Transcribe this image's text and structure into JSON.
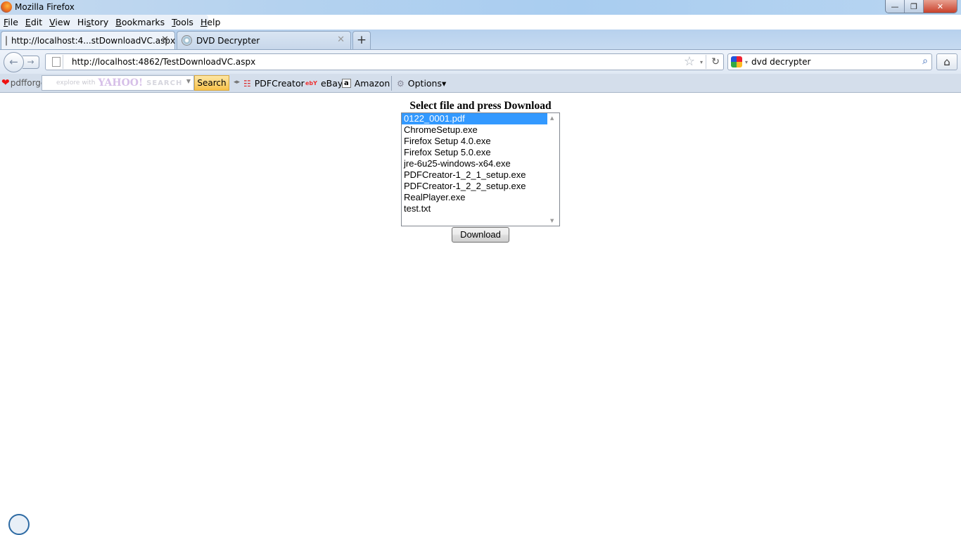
{
  "window": {
    "title": "Mozilla Firefox",
    "controls": {
      "minimize": "—",
      "maximize": "❐",
      "close": "✕"
    }
  },
  "menubar": {
    "items": [
      {
        "label": "File",
        "key": "F",
        "rest": "ile"
      },
      {
        "label": "Edit",
        "key": "E",
        "rest": "dit"
      },
      {
        "label": "View",
        "key": "V",
        "rest": "iew"
      },
      {
        "label": "History",
        "pre": "Hi",
        "key": "s",
        "rest": "tory"
      },
      {
        "label": "Bookmarks",
        "key": "B",
        "rest": "ookmarks"
      },
      {
        "label": "Tools",
        "key": "T",
        "rest": "ools"
      },
      {
        "label": "Help",
        "key": "H",
        "rest": "elp"
      }
    ]
  },
  "tabs": [
    {
      "label": "http://localhost:4...stDownloadVC.aspx",
      "active": true,
      "close": "✕"
    },
    {
      "label": "DVD Decrypter",
      "active": false,
      "close": "✕"
    }
  ],
  "new_tab": "+",
  "navbar": {
    "back_icon": "←",
    "forward_icon": "→",
    "url": "http://localhost:4862/TestDownloadVC.aspx",
    "star_icon": "☆",
    "dropdown_icon": "▾",
    "reload_icon": "↻",
    "search_query": "dvd decrypter",
    "search_icon": "⌕",
    "home_icon": "⌂"
  },
  "pdfforge_toolbar": {
    "logo": "pdfforge",
    "yahoo_prefix": "explore with",
    "yahoo_brand": "YAHOO!",
    "yahoo_search_word": "SEARCH",
    "search_button": "Search",
    "items": [
      {
        "name": "pdfcreator",
        "icon": "☷",
        "label": "PDFCreator"
      },
      {
        "name": "ebay",
        "icon": "ebY",
        "label": "eBay"
      },
      {
        "name": "amazon",
        "icon": "a",
        "label": "Amazon"
      },
      {
        "name": "options",
        "icon": "⚙",
        "label": "Options▾"
      }
    ]
  },
  "page": {
    "heading": "Select file and press Download",
    "files": [
      "0122_0001.pdf",
      "ChromeSetup.exe",
      "Firefox Setup 4.0.exe",
      "Firefox Setup 5.0.exe",
      "jre-6u25-windows-x64.exe",
      "PDFCreator-1_2_1_setup.exe",
      "PDFCreator-1_2_2_setup.exe",
      "RealPlayer.exe",
      "test.txt"
    ],
    "selected_index": 0,
    "download_button": "Download"
  },
  "colors": {
    "selection": "#3399ff",
    "close_button": "#c8412b",
    "search_button": "#f8c24a"
  }
}
